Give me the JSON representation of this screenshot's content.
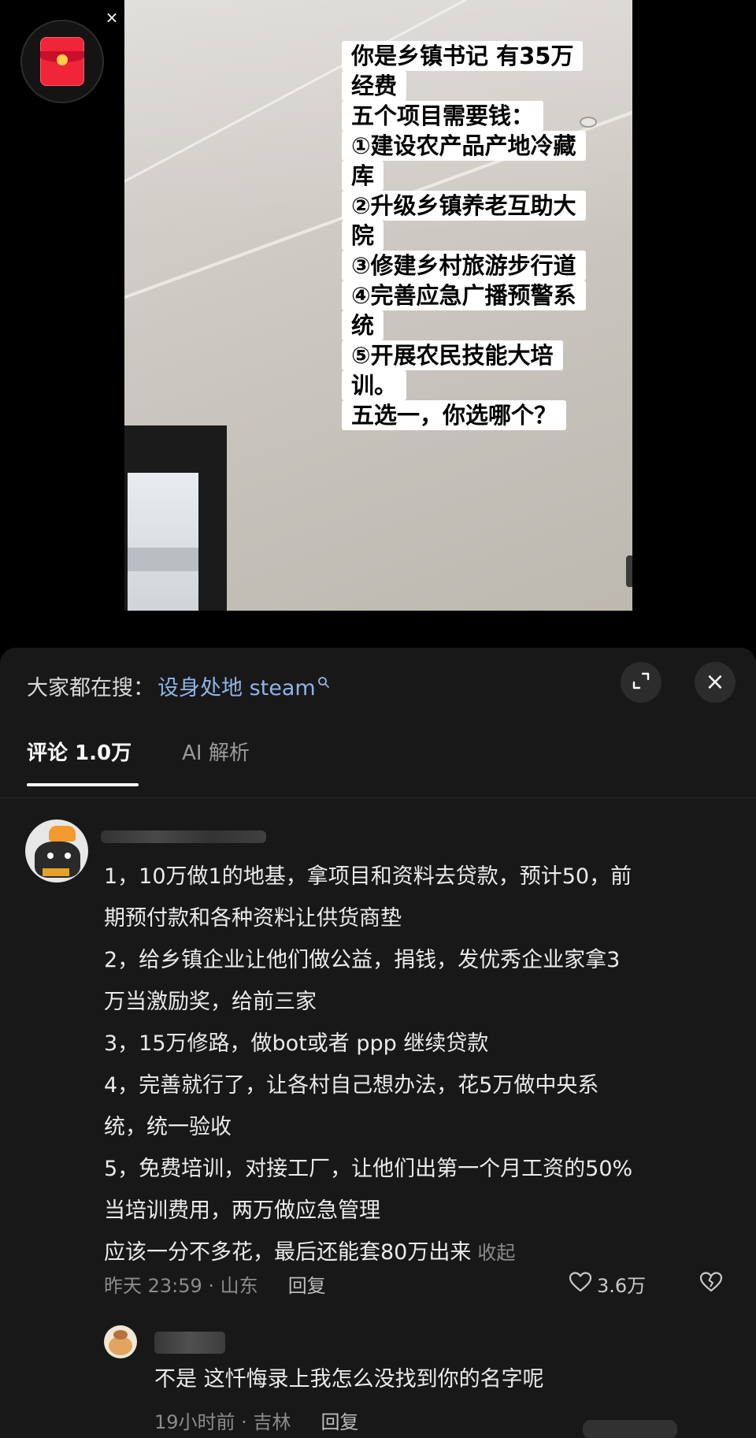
{
  "video": {
    "overlay_lines": [
      "你是乡镇书记 有35万",
      "经费",
      "五个项目需要钱：",
      "①建设农产品产地冷藏",
      "库",
      "②升级乡镇养老互助大",
      "院",
      "③修建乡村旅游步行道",
      "④完善应急广播预警系",
      "统",
      "⑤开展农民技能大培",
      "训。",
      "五选一，你选哪个？"
    ],
    "redpacket_close": "×"
  },
  "search": {
    "prefix": "大家都在搜：",
    "term": "设身处地 steam",
    "icon": "search-icon"
  },
  "panel": {
    "close_glyph": "×"
  },
  "tabs": [
    {
      "label": "评论 1.0万",
      "active": true
    },
    {
      "label": "AI 解析",
      "active": false
    }
  ],
  "comment": {
    "lines": [
      "1，10万做1的地基，拿项目和资料去贷款，预计50，前",
      "期预付款和各种资料让供货商垫",
      "2，给乡镇企业让他们做公益，捐钱，发优秀企业家拿3",
      "万当激励奖，给前三家",
      "3，15万修路，做bot或者 ppp  继续贷款",
      "4，完善就行了，让各村自己想办法，花5万做中央系",
      "统，统一验收",
      "5，免费培训，对接工厂，让他们出第一个月工资的50%",
      "当培训费用，两万做应急管理",
      "应该一分不多花，最后还能套80万出来"
    ],
    "collapse_label": "收起",
    "time_location": "昨天 23:59 · 山东",
    "reply_label": "回复",
    "like_count": "3.6万"
  },
  "reply": {
    "text": "不是 这忏悔录上我怎么没找到你的名字呢",
    "time_location": "19小时前 · 吉林",
    "reply_label": "回复"
  },
  "colors": {
    "panel_bg": "#181818",
    "link_blue": "#8fb4e6",
    "redpacket": "#f0253a"
  }
}
